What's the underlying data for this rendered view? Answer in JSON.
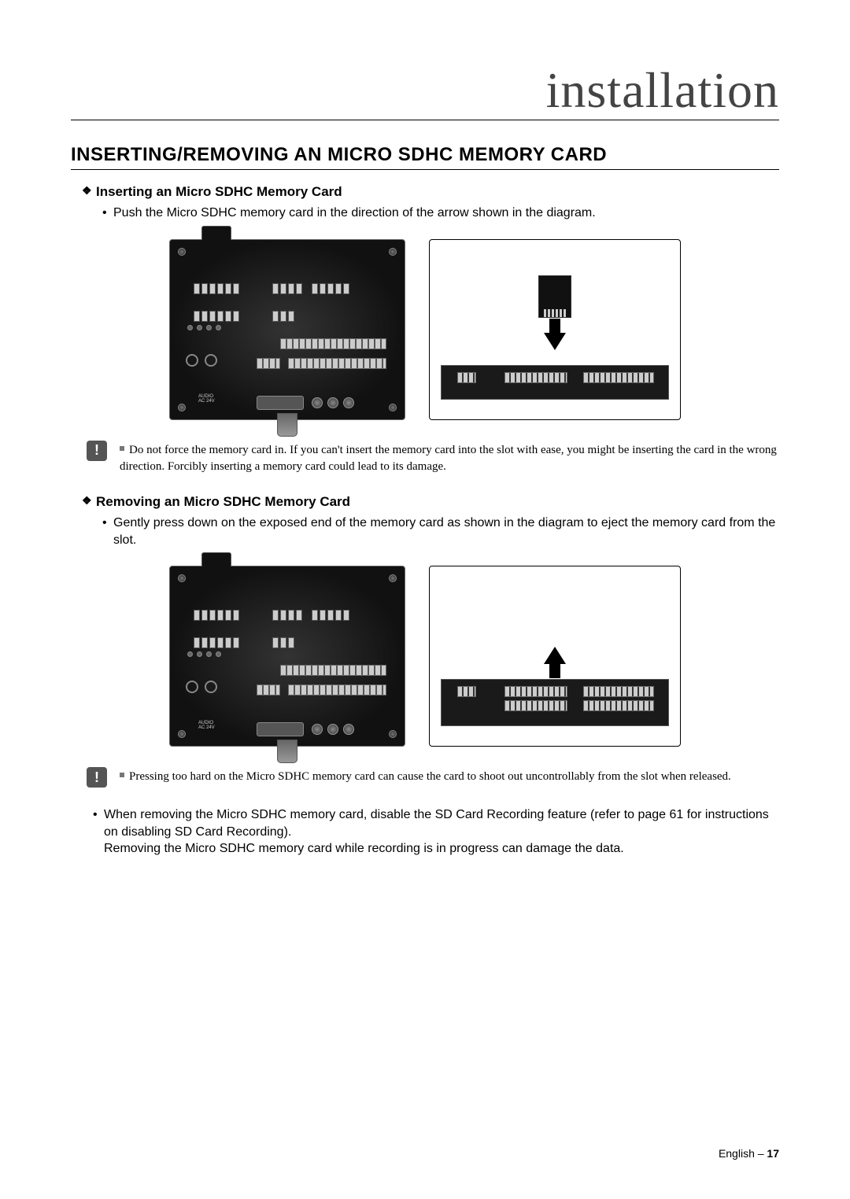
{
  "header": {
    "title": "installation"
  },
  "section": {
    "heading": "INSERTING/REMOVING AN MICRO SDHC MEMORY CARD"
  },
  "insert": {
    "subheading": "Inserting an Micro SDHC Memory Card",
    "bullet1": "Push the Micro SDHC memory card in the direction of the arrow shown in the diagram.",
    "note": "Do not force the memory card in. If you can't insert the memory card into the slot with ease, you might be inserting the card in the wrong direction. Forcibly inserting a memory card could lead to its damage."
  },
  "remove": {
    "subheading": "Removing an Micro SDHC Memory Card",
    "bullet1": "Gently press down on the exposed end of the memory card as shown in the diagram to eject the memory card from the slot.",
    "note": "Pressing too hard on the Micro SDHC memory card can cause the card to shoot out uncontrollably from the slot when released.",
    "bullet2": "When removing the Micro SDHC memory card, disable the SD Card Recording feature (refer to page 61 for instructions on disabling SD Card Recording).\nRemoving the Micro SDHC memory card while recording is in progress can damage the data."
  },
  "device_labels": {
    "power": "AC 24V",
    "audio": "AUDIO"
  },
  "footer": {
    "lang": "English – ",
    "page": "17"
  },
  "icons": {
    "alert": "!"
  }
}
